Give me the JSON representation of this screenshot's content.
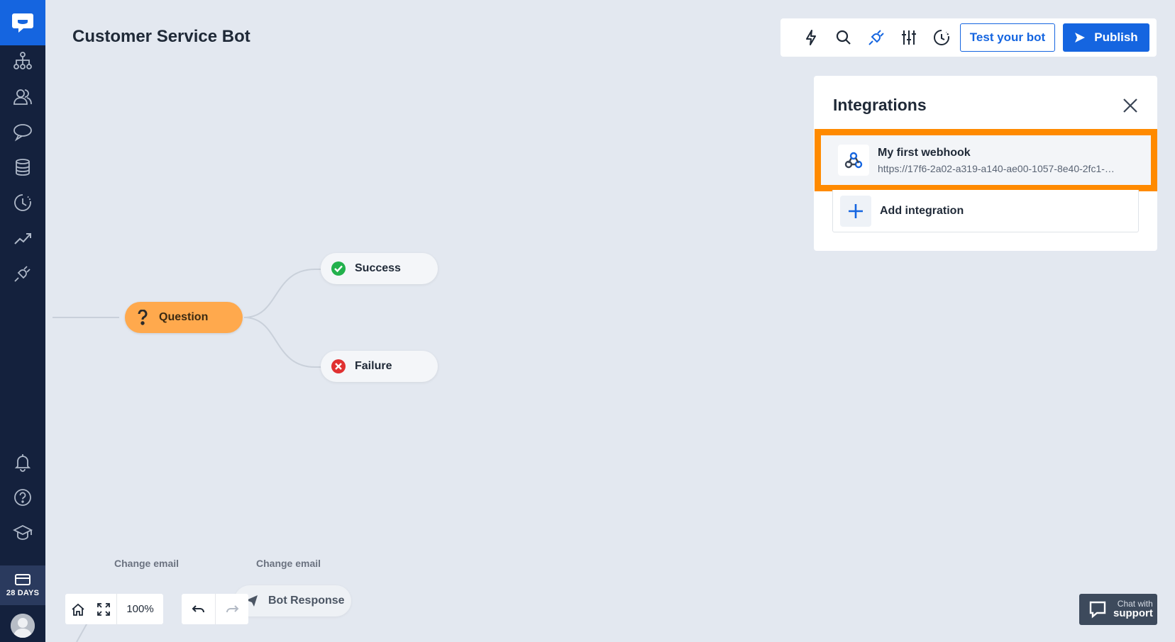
{
  "app": {
    "title": "Customer Service Bot",
    "trial_days": "28 DAYS",
    "accent_color": "#1565e0",
    "highlight_color": "#ff8a00"
  },
  "sidebar": {
    "items": [
      {
        "icon": "flow-icon"
      },
      {
        "icon": "users-icon"
      },
      {
        "icon": "chat-bubble-icon"
      },
      {
        "icon": "database-icon"
      },
      {
        "icon": "history-icon"
      },
      {
        "icon": "analytics-icon"
      },
      {
        "icon": "plug-icon"
      }
    ],
    "bottom_items": [
      {
        "icon": "bell-icon"
      },
      {
        "icon": "help-icon"
      },
      {
        "icon": "academy-icon"
      }
    ]
  },
  "toolbar": {
    "icons": [
      "lightning-icon",
      "search-icon",
      "plug-icon",
      "sliders-icon",
      "history-icon"
    ],
    "test_label": "Test your bot",
    "publish_label": "Publish"
  },
  "integrations": {
    "title": "Integrations",
    "items": [
      {
        "name": "My first webhook",
        "url": "https://17f6-2a02-a319-a140-ae00-1057-8e40-2fc1-…"
      }
    ],
    "add_label": "Add integration"
  },
  "canvas": {
    "nodes": {
      "question": "Question",
      "success": "Success",
      "failure": "Failure",
      "bot_response": "Bot Response"
    },
    "edge_labels": [
      "Change email",
      "Change email"
    ]
  },
  "controls": {
    "zoom": "100%"
  },
  "support": {
    "line1": "Chat with",
    "line2": "support"
  }
}
